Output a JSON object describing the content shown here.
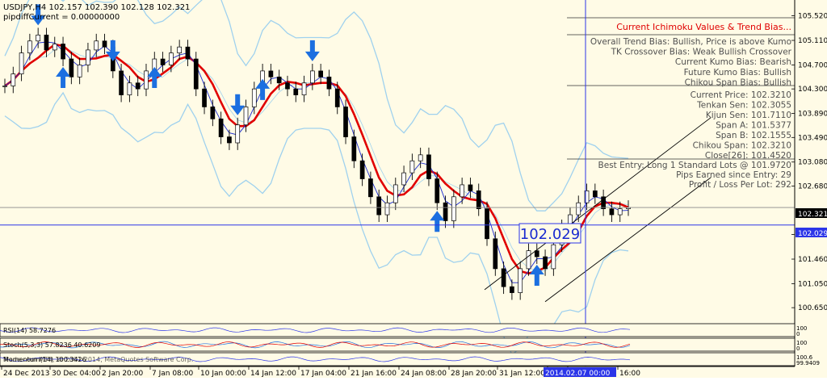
{
  "header": {
    "symbol_line": "USDJPY,H4  102.157 102.390 102.128 102.321",
    "indicator_line": "pipdiffCurrent = 0.00000000"
  },
  "info_panel": {
    "title": "Current Ichimoku Values & Trend Bias...",
    "bias_lines": [
      "Overall Trend Bias: Bullish, Price is above Kumo",
      "TK Crossover Bias: Weak Bullish Crossover",
      "Current Kumo Bias: Bearish",
      "Future Kumo Bias: Bullish",
      "Chikou Span Bias: Bullish"
    ],
    "value_lines": [
      "Current Price: 102.3210",
      "Tenkan Sen: 102.3055",
      "Kijun Sen: 101.7110",
      "Span A: 101.5377",
      "Span B: 102.1555",
      "Chikou Span: 102.3210",
      "Close[26]: 101.4520"
    ],
    "entry_lines": [
      "Best Entry: Long 1 Standard Lots @ 101.9720",
      "Pips Earned since Entry: 29",
      "Profit / Loss Per Lot: 292"
    ]
  },
  "price_axis": {
    "ticks": [
      "105.520",
      "105.110",
      "104.700",
      "104.300",
      "103.890",
      "103.490",
      "103.080",
      "102.680",
      "101.870",
      "101.460",
      "101.050",
      "100.650"
    ],
    "current_price_label": "102.321",
    "entry_price_label": "102.029"
  },
  "entry_marker_label": "102.029",
  "sub_panels": [
    {
      "label": "RSI(14) 58.7276",
      "scale_top": "100",
      "scale_bottom": "0"
    },
    {
      "label": "Stoch(5,3,3) 57.8236 40.6209",
      "scale_top": "100",
      "scale_bottom": "0"
    },
    {
      "label": "Momentum(14) 100.3426",
      "scale_top": "100.6",
      "scale_bottom": "99.9409"
    }
  ],
  "copyright": "Trade.com MT4, © 2001-2014, MetaQuotes Software Corp.",
  "time_axis": {
    "labels": [
      "24 Dec 2013",
      "30 Dec 04:00",
      "2 Jan 20:00",
      "7 Jan 08:00",
      "10 Jan 00:00",
      "14 Jan 12:00",
      "17 Jan 04:00",
      "21 Jan 16:00",
      "24 Jan 08:00",
      "28 Jan 20:00",
      "31 Jan 12:00",
      "5",
      "2014.02.07 00:00",
      "16:00"
    ]
  },
  "colors": {
    "background": "#fffbe6",
    "grid": "#c8c8c8",
    "candle": "#000000",
    "bollinger": "#9fd1ee",
    "ma_fast": "#e00000",
    "ma_slow": "#1a2bd0",
    "blue_line": "#2b35e8",
    "arrow": "#1c6fe0",
    "title_red": "#e00000",
    "panel_text": "#505050"
  },
  "chart_data": {
    "type": "candlestick",
    "symbol": "USDJPY",
    "timeframe": "H4",
    "ohlc": {
      "open": 102.157,
      "high": 102.39,
      "low": 102.128,
      "close": 102.321
    },
    "ylim": [
      100.45,
      105.73
    ],
    "y_ticks": [
      105.52,
      105.11,
      104.7,
      104.3,
      103.89,
      103.49,
      103.08,
      102.68,
      101.87,
      101.46,
      101.05,
      100.65
    ],
    "horizontal_lines": [
      102.321,
      102.029
    ],
    "close_series": [
      104.35,
      104.55,
      104.9,
      105.1,
      105.2,
      104.95,
      105.05,
      104.8,
      104.5,
      104.7,
      104.95,
      105.1,
      105.0,
      104.6,
      104.2,
      104.4,
      104.3,
      104.6,
      104.8,
      104.7,
      104.9,
      105.0,
      104.8,
      104.3,
      104.0,
      103.8,
      103.5,
      103.4,
      103.7,
      104.0,
      104.3,
      104.6,
      104.5,
      104.4,
      104.3,
      104.2,
      104.4,
      104.6,
      104.5,
      104.3,
      104.0,
      103.5,
      103.1,
      102.8,
      102.5,
      102.2,
      102.4,
      102.7,
      102.9,
      103.1,
      103.2,
      102.8,
      102.4,
      102.1,
      102.5,
      102.7,
      102.6,
      102.3,
      101.8,
      101.3,
      101.0,
      100.9,
      101.3,
      101.6,
      101.5,
      101.3,
      101.7,
      102.0,
      102.2,
      102.4,
      102.6,
      102.5,
      102.3,
      102.2,
      102.3,
      102.321
    ],
    "buy_arrows": [
      7,
      18,
      31,
      52,
      64
    ],
    "sell_arrows": [
      4,
      13,
      28,
      37
    ]
  }
}
